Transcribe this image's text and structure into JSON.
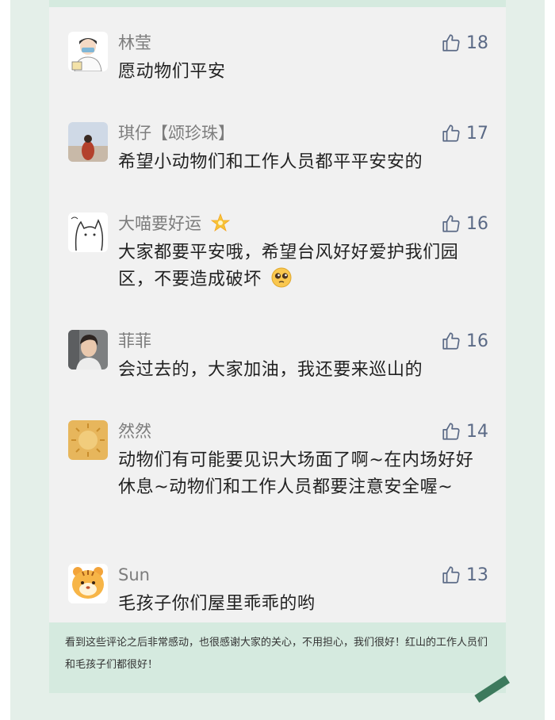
{
  "comments": [
    {
      "name": "林莹",
      "text": "愿动物们平安",
      "likes": "18",
      "avatar": "doctor-avatar"
    },
    {
      "name": "琪仔【颂珍珠】",
      "text": "希望小动物们和工作人员都平平安安的",
      "likes": "17",
      "avatar": "person-sky-avatar"
    },
    {
      "name": "大喵要好运",
      "name_emoji": "star-emoji",
      "text": "大家都要平安哦，希望台风好好爱护我们园区，不要造成破坏",
      "text_emoji": "pleading-face-emoji",
      "likes": "16",
      "avatar": "cat-sketch-avatar"
    },
    {
      "name": "菲菲",
      "text": "会过去的，大家加油，我还要来巡山的",
      "likes": "16",
      "avatar": "woman-car-avatar"
    },
    {
      "name": "然然",
      "text": "动物们有可能要见识大场面了啊~在内场好好休息~动物们和工作人员都要注意安全喔~",
      "likes": "14",
      "avatar": "golden-sun-avatar"
    },
    {
      "name": "Sun",
      "text": "毛孩子你们屋里乖乖的哟",
      "likes": "13",
      "avatar": "tiger-avatar"
    }
  ],
  "footer": {
    "text": "看到这些评论之后非常感动，也很感谢大家的关心，不用担心，我们很好！红山的工作人员们和毛孩子们都很好！"
  },
  "colors": {
    "outer_bg": "#e4efe9",
    "card_bg": "#f1f1f1",
    "footer_bg": "#d5eadf",
    "like_icon": "#5b6a86",
    "corner_accent": "#3d7a5d"
  }
}
